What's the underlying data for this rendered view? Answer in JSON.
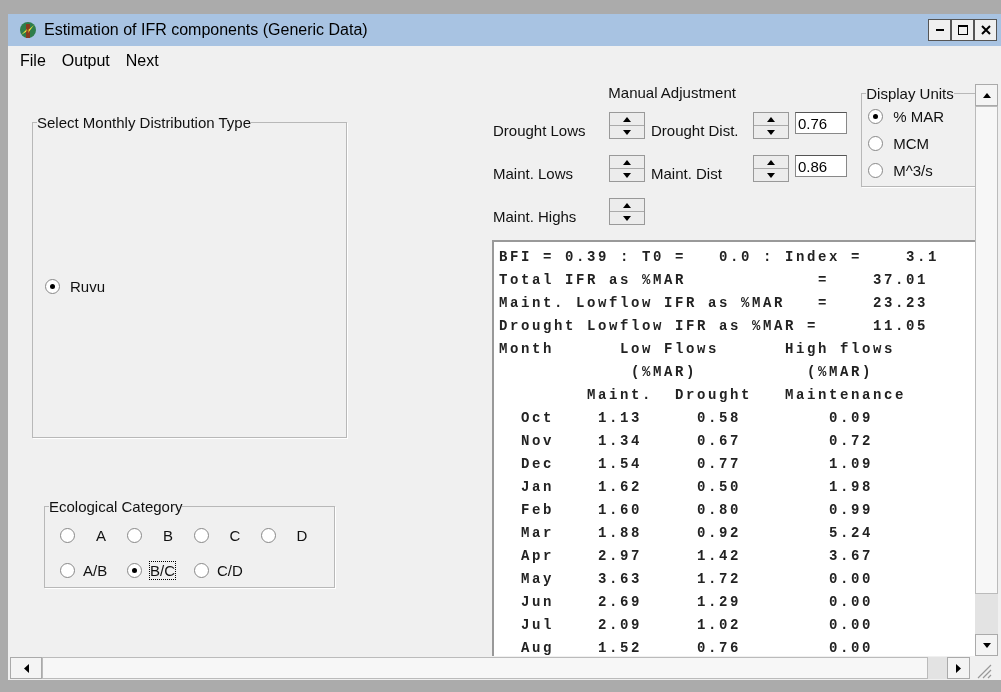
{
  "window": {
    "title": "Estimation of IFR components (Generic Data)"
  },
  "menu": [
    "File",
    "Output",
    "Next"
  ],
  "distribution_type": {
    "title": "Select Monthly Distribution Type",
    "options": [
      {
        "label": "Ruvu",
        "selected": true
      }
    ]
  },
  "ecological_category": {
    "title": "Ecological Category",
    "rows": [
      [
        {
          "label": "A",
          "selected": false,
          "focused": false
        },
        {
          "label": "B",
          "selected": false,
          "focused": false
        },
        {
          "label": "C",
          "selected": false,
          "focused": false
        },
        {
          "label": "D",
          "selected": false,
          "focused": false
        }
      ],
      [
        {
          "label": "A/B",
          "selected": false,
          "focused": false
        },
        {
          "label": "B/C",
          "selected": true,
          "focused": true
        },
        {
          "label": "C/D",
          "selected": false,
          "focused": false
        }
      ]
    ]
  },
  "manual_adjustment": {
    "title": "Manual Adjustment",
    "rows": [
      {
        "label": "Drought Lows",
        "dist_label": "Drought Dist.",
        "value": "0.76"
      },
      {
        "label": "Maint. Lows",
        "dist_label": "Maint. Dist",
        "value": "0.86"
      },
      {
        "label": "Maint. Highs"
      }
    ]
  },
  "display_units": {
    "title": "Display Units",
    "options": [
      {
        "label": "% MAR",
        "selected": true
      },
      {
        "label": "MCM",
        "selected": false
      },
      {
        "label": "M^3/s",
        "selected": false
      }
    ]
  },
  "output_lines": [
    "BFI = 0.39 : T0 =   0.0 : Index =    3.1",
    "Total IFR as %MAR            =    37.01",
    "Maint. Lowflow IFR as %MAR   =    23.23",
    "Drought Lowflow IFR as %MAR =     11.05",
    "Month      Low Flows      High flows",
    "            (%MAR)          (%MAR)",
    "        Maint.  Drought   Maintenance",
    "  Oct    1.13     0.58        0.09",
    "  Nov    1.34     0.67        0.72",
    "  Dec    1.54     0.77        1.09",
    "  Jan    1.62     0.50        1.98",
    "  Feb    1.60     0.80        0.99",
    "  Mar    1.88     0.92        5.24",
    "  Apr    2.97     1.42        3.67",
    "  May    3.63     1.72        0.00",
    "  Jun    2.69     1.29        0.00",
    "  Jul    2.09     1.02        0.00",
    "  Aug    1.52     0.76        0.00"
  ]
}
